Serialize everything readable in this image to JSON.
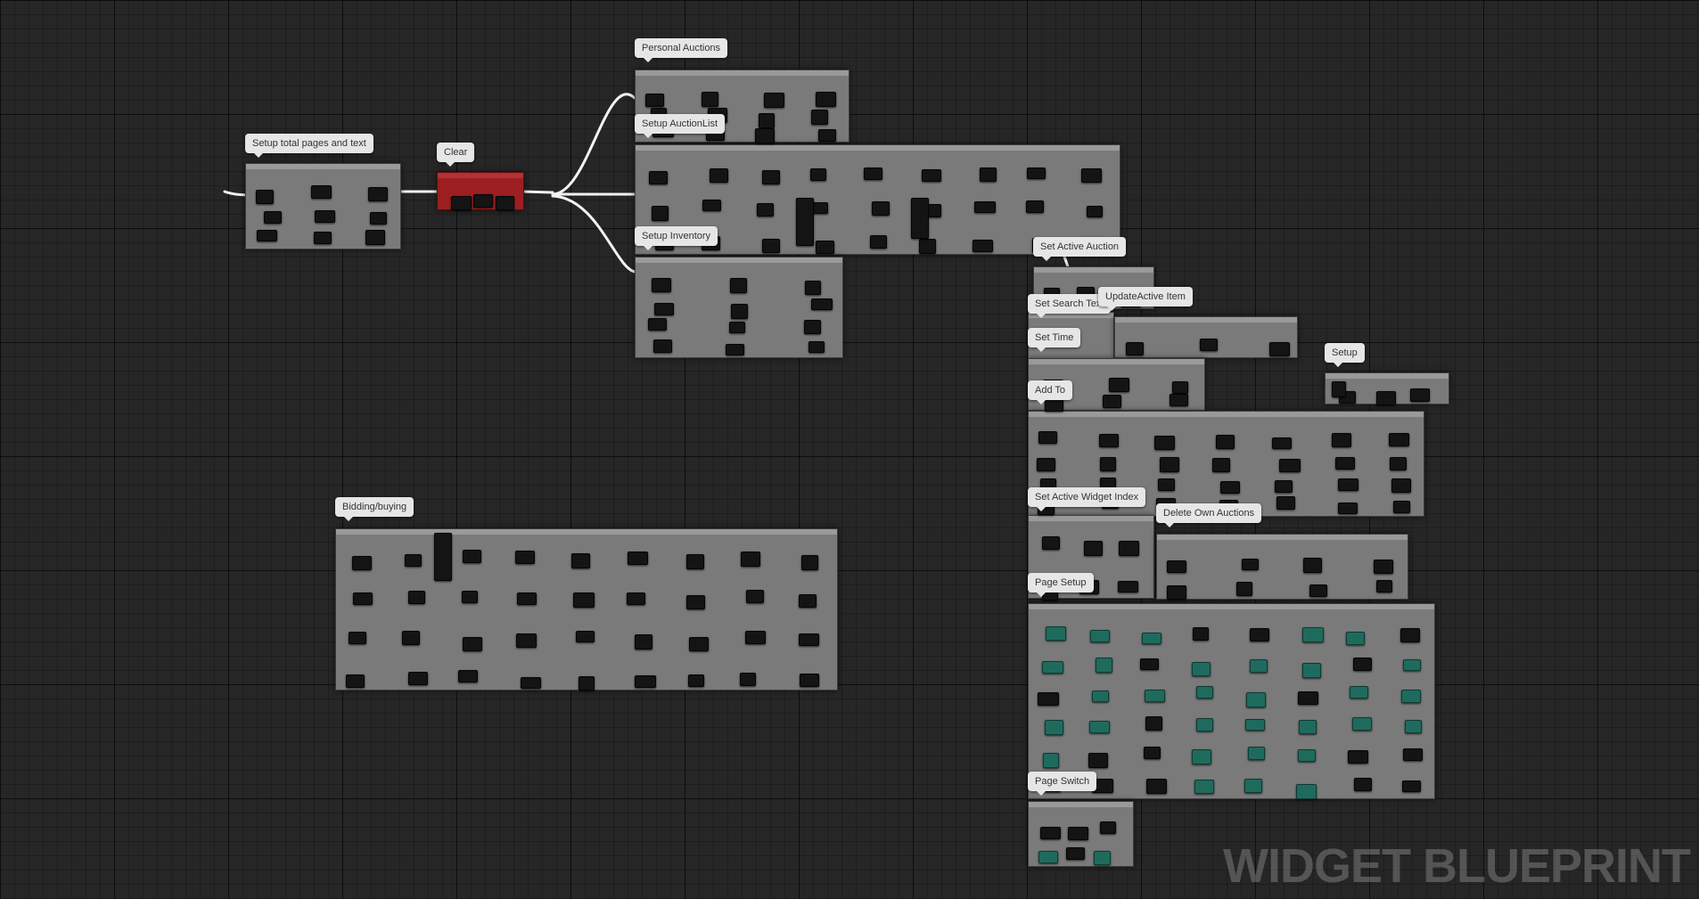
{
  "watermark": "WIDGET BLUEPRINT",
  "colors": {
    "canvas_bg": "#262626",
    "comment_bg": "#7a7a7a",
    "comment_label_bg": "#e6e6e6",
    "highlight_comment": "#9c1f21",
    "node_body": "#141414",
    "exec_wire": "#f2f2f2",
    "wire_blue": "#2f8fd4",
    "wire_magenta": "#d061d6",
    "wire_green": "#9fe83c",
    "wire_teal": "#3cc6a8",
    "wire_red": "#c92b2b"
  },
  "comments": [
    {
      "name": "setup-total-pages-and-text",
      "label": "Setup total pages and text"
    },
    {
      "name": "clear",
      "label": "Clear"
    },
    {
      "name": "personal-auctions",
      "label": "Personal Auctions"
    },
    {
      "name": "setup-auctionlist",
      "label": "Setup AuctionList"
    },
    {
      "name": "setup-inventory",
      "label": "Setup Inventory"
    },
    {
      "name": "set-active-auction",
      "label": "Set Active Auction"
    },
    {
      "name": "set-search-text",
      "label": "Set Search Text"
    },
    {
      "name": "update-active-item",
      "label": "UpdateActive Item"
    },
    {
      "name": "set-time",
      "label": "Set Time"
    },
    {
      "name": "setup",
      "label": "Setup"
    },
    {
      "name": "add-to",
      "label": "Add To"
    },
    {
      "name": "bidding-buying",
      "label": "Bidding/buying"
    },
    {
      "name": "set-active-widget-index",
      "label": "Set Active Widget Index"
    },
    {
      "name": "delete-own-auctions",
      "label": "Delete Own Auctions"
    },
    {
      "name": "page-setup",
      "label": "Page Setup"
    },
    {
      "name": "page-switch",
      "label": "Page Switch"
    }
  ]
}
